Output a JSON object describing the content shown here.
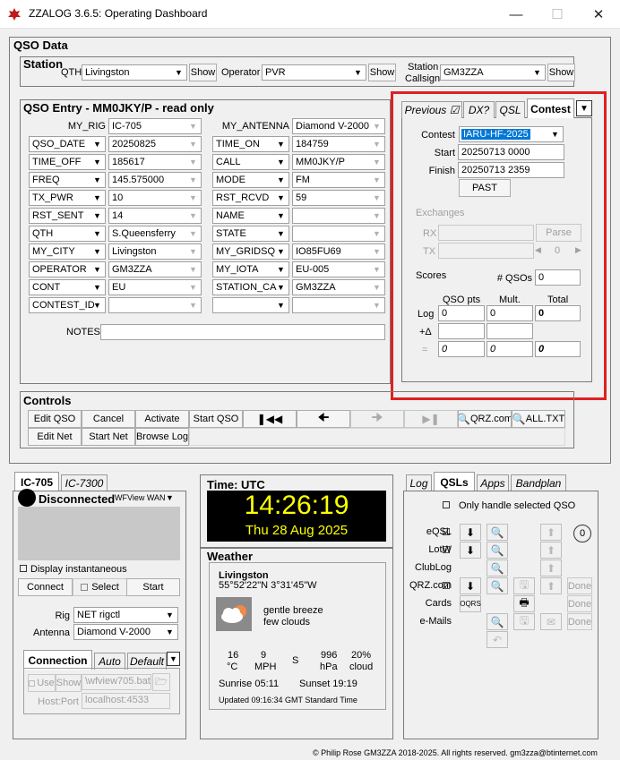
{
  "window": {
    "title": "ZZALOG 3.6.5: Operating Dashboard"
  },
  "qso_data": {
    "title": "QSO Data"
  },
  "station": {
    "title": "Station",
    "qth_label": "QTH",
    "qth_value": "Livingston",
    "operator_label": "Operator",
    "operator_value": "PVR",
    "callsign_label_1": "Station",
    "callsign_label_2": "Callsign",
    "callsign_value": "GM3ZZA",
    "show_label": "Show"
  },
  "qso_entry": {
    "title": "QSO Entry - MM0JKY/P - read only",
    "my_rig_label": "MY_RIG",
    "my_rig_value": "IC-705",
    "my_antenna_label": "MY_ANTENNA",
    "my_antenna_value": "Diamond V-2000",
    "rows": [
      {
        "left_field": "QSO_DATE",
        "left_value": "20250825",
        "right_field": "TIME_ON",
        "right_value": "184759"
      },
      {
        "left_field": "TIME_OFF",
        "left_value": "185617",
        "right_field": "CALL",
        "right_value": "MM0JKY/P"
      },
      {
        "left_field": "FREQ",
        "left_value": "145.575000",
        "right_field": "MODE",
        "right_value": "FM"
      },
      {
        "left_field": "TX_PWR",
        "left_value": "10",
        "right_field": "RST_RCVD",
        "right_value": "59"
      },
      {
        "left_field": "RST_SENT",
        "left_value": "14",
        "right_field": "NAME",
        "right_value": ""
      },
      {
        "left_field": "QTH",
        "left_value": "S.Queensferry",
        "right_field": "STATE",
        "right_value": ""
      },
      {
        "left_field": "MY_CITY",
        "left_value": "Livingston",
        "right_field": "MY_GRIDSQ",
        "right_value": "IO85FU69"
      },
      {
        "left_field": "OPERATOR",
        "left_value": "GM3ZZA",
        "right_field": "MY_IOTA",
        "right_value": "EU-005"
      },
      {
        "left_field": "CONT",
        "left_value": "EU",
        "right_field": "STATION_CA",
        "right_value": "GM3ZZA"
      },
      {
        "left_field": "CONTEST_ID",
        "left_value": "",
        "right_field": "",
        "right_value": ""
      }
    ],
    "notes_label": "NOTES"
  },
  "right_tabs": {
    "tabs": [
      "Previous ☑",
      "DX?",
      "QSL",
      "Contest"
    ],
    "contest_label": "Contest",
    "contest_value": "IARU-HF-2025",
    "start_label": "Start",
    "start_value": "20250713 0000",
    "finish_label": "Finish",
    "finish_value": "20250713 2359",
    "past_label": "PAST",
    "exchanges_label": "Exchanges",
    "rx_label": "RX",
    "tx_label": "TX",
    "parse_label": "Parse",
    "tx_counter": "0",
    "scores_label": "Scores",
    "num_qsos_label": "# QSOs",
    "num_qsos_value": "0",
    "col_qso_pts": "QSO pts",
    "col_mult": "Mult.",
    "col_total": "Total",
    "log_label": "Log",
    "log_pts": "0",
    "log_mult": "0",
    "log_total": "0",
    "delta_label": "+Δ",
    "eq_label": "=",
    "eq_pts": "0",
    "eq_mult": "0",
    "eq_total": "0"
  },
  "controls": {
    "title": "Controls",
    "row1": [
      "Edit QSO",
      "Cancel",
      "Activate",
      "Start QSO"
    ],
    "row2": [
      "Edit Net",
      "Start Net",
      "Browse Log"
    ],
    "qrz_label": "QRZ.com",
    "alltxt_label": "ALL.TXT"
  },
  "rig": {
    "tabs": [
      "IC-705",
      "IC-7300"
    ],
    "status": "Disconnected",
    "wan_label": "WFView WAN",
    "instantaneous_label": "Display instantaneous",
    "connect_label": "Connect",
    "select_label": "Select",
    "start_label": "Start",
    "rig_label": "Rig",
    "rig_value": "NET rigctl",
    "antenna_label": "Antenna",
    "antenna_value": "Diamond V-2000",
    "sub_tabs": [
      "Connection",
      "Auto",
      "Default"
    ],
    "use_label": "Use",
    "show_label": "Show",
    "bat_path": "\\wfview705.bat",
    "hostport_label": "Host:Port",
    "hostport_value": "localhost:4533"
  },
  "clock": {
    "title": "Time: UTC",
    "time": "14:26:19",
    "date": "Thu 28 Aug 2025"
  },
  "weather": {
    "title": "Weather",
    "location": "Livingston",
    "coords": "55°52'22\"N 3°31'45\"W",
    "desc_1": "gentle breeze",
    "desc_2": "few clouds",
    "temp": "16",
    "temp_unit": "°C",
    "wind": "9",
    "wind_unit": "MPH",
    "wind_dir": "S",
    "pressure": "996",
    "pressure_unit": "hPa",
    "cloud": "20%",
    "cloud_unit": "cloud",
    "sunrise": "Sunrise 05:11",
    "sunset": "Sunset 19:19",
    "updated": "Updated 09:16:34 GMT Standard Time"
  },
  "qsl": {
    "tabs": [
      "Log",
      "QSLs",
      "Apps",
      "Bandplan"
    ],
    "only_selected_label": "Only handle selected QSO",
    "count": "0",
    "services": [
      "eQSL",
      "LotW",
      "ClubLog",
      "QRZ.com",
      "Cards",
      "e-Mails"
    ],
    "oqrs_label": "OQRS",
    "done_label": "Done"
  },
  "footer": {
    "copyright": "© Philip Rose GM3ZZA 2018-2025. All rights reserved. gm3zza@btinternet.com"
  },
  "colors": {
    "highlight_red": "#e02020",
    "clock_bg": "#000000",
    "clock_fg": "#ffff00",
    "selection_blue": "#0078d7"
  }
}
